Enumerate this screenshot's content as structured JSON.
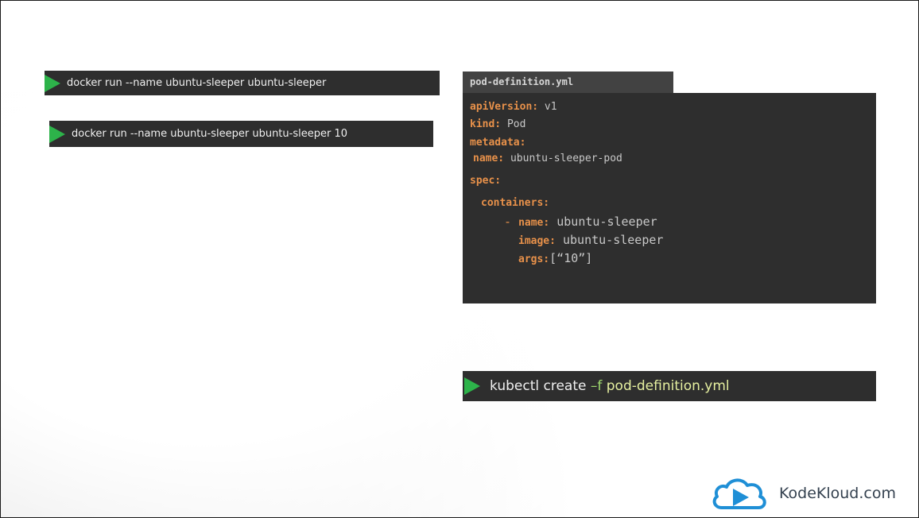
{
  "terminals": {
    "docker_run_1": "docker run --name ubuntu-sleeper ubuntu-sleeper",
    "docker_run_2": "docker run --name ubuntu-sleeper ubuntu-sleeper 10",
    "kubectl": {
      "prefix": "kubectl create ",
      "flag": "–f",
      "file": " pod-definition.yml"
    }
  },
  "yaml_file": {
    "filename": "pod-definition.yml",
    "lines": {
      "apiVersion_key": "apiVersion:",
      "apiVersion_val": "v1",
      "kind_key": "kind:",
      "kind_val": "Pod",
      "metadata_key": "metadata:",
      "name_key": "name:",
      "name_val": "ubuntu-sleeper-pod",
      "spec_key": "spec:",
      "containers_key": "containers:",
      "dash": "- ",
      "cname_key": "name:",
      "cname_val": "ubuntu-sleeper",
      "image_key": "image:",
      "image_val": "ubuntu-sleeper",
      "args_key": "args:",
      "args_val": "[“10”]"
    }
  },
  "brand": {
    "name": "KodeKloud.com",
    "icon": "kodekloud-cloud-play-logo"
  },
  "colors": {
    "terminal_bg": "#2e2e2e",
    "play_green": "#2db34a",
    "yaml_key": "#e8914a"
  }
}
